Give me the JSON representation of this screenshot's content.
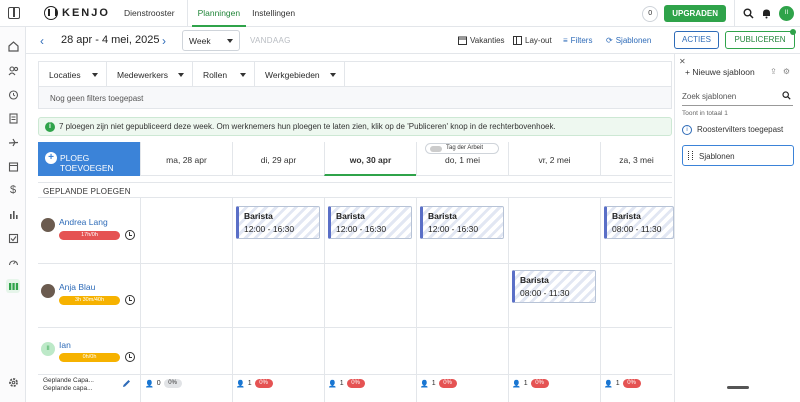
{
  "app": {
    "logo_text": "KENJO"
  },
  "topbar": {
    "tabs": [
      "Dienstrooster",
      "Planningen",
      "Instellingen"
    ],
    "active_tab": "Planningen",
    "notification_count": "0",
    "upgrade_label": "UPGRADEN",
    "avatar_initials": "II"
  },
  "toolbar": {
    "date_range": "28 apr - 4 mei, 2025",
    "view_select": "Week",
    "today_label": "VANDAAG",
    "holidays_label": "Vakanties",
    "layout_label": "Lay-out",
    "filters_label": "Filters",
    "templates_label": "Sjablonen",
    "actions_label": "ACTIES",
    "publish_label": "PUBLICEREN"
  },
  "filters": {
    "items": [
      "Locaties",
      "Medewerkers",
      "Rollen",
      "Werkgebieden"
    ],
    "empty_text": "Nog geen filters toegepast"
  },
  "banner": {
    "text": "7 ploegen zijn niet gepubliceerd deze week. Om werknemers hun ploegen te laten zien, klik op de 'Publiceren' knop in de rechterbovenhoek."
  },
  "grid": {
    "add_shift_label": "PLOEG TOEVOEGEN",
    "holiday_tag": "Tag der Arbeit",
    "section_title": "GEPLANDE PLOEGEN",
    "days": [
      "ma, 28 apr",
      "di, 29 apr",
      "wo, 30 apr",
      "do, 1 mei",
      "vr, 2 mei",
      "za, 3 mei"
    ],
    "today_index": 2,
    "employees": [
      {
        "name": "Andrea Lang",
        "hours": "17h/0h",
        "hours_color": "red"
      },
      {
        "name": "Anja Blau",
        "hours": "3h 30m/40h",
        "hours_color": "orange"
      },
      {
        "name": "Ian",
        "hours": "0h/0h",
        "hours_color": "orange",
        "initials": "II"
      }
    ],
    "shifts": [
      {
        "role": "Barista",
        "time": "12:00 - 16:30"
      },
      {
        "role": "Barista",
        "time": "12:00 - 16:30"
      },
      {
        "role": "Barista",
        "time": "12:00 - 16:30"
      },
      {
        "role": "Barista",
        "time": "08:00 - 11:30"
      },
      {
        "role": "Barista",
        "time": "08:00 - 11:30"
      }
    ],
    "footer_labels": [
      "Geplande Capa...",
      "Geplande capa..."
    ],
    "footer_stats": [
      {
        "count": "0",
        "pct": "0%",
        "color": "grey"
      },
      {
        "count": "1",
        "pct": "0%",
        "color": "red"
      },
      {
        "count": "1",
        "pct": "0%",
        "color": "red"
      },
      {
        "count": "1",
        "pct": "0%",
        "color": "red"
      },
      {
        "count": "1",
        "pct": "0%",
        "color": "red"
      },
      {
        "count": "1",
        "pct": "0%",
        "color": "red"
      }
    ]
  },
  "templates_panel": {
    "new_template": "Nieuwe sjabloon",
    "search_placeholder": "Zoek sjablonen",
    "total": "Toont in totaal 1",
    "items": [
      "Roostervilters toegepast",
      "Sjablonen"
    ]
  },
  "colors": {
    "accent": "#2fa34a",
    "blue": "#3b83d8"
  }
}
